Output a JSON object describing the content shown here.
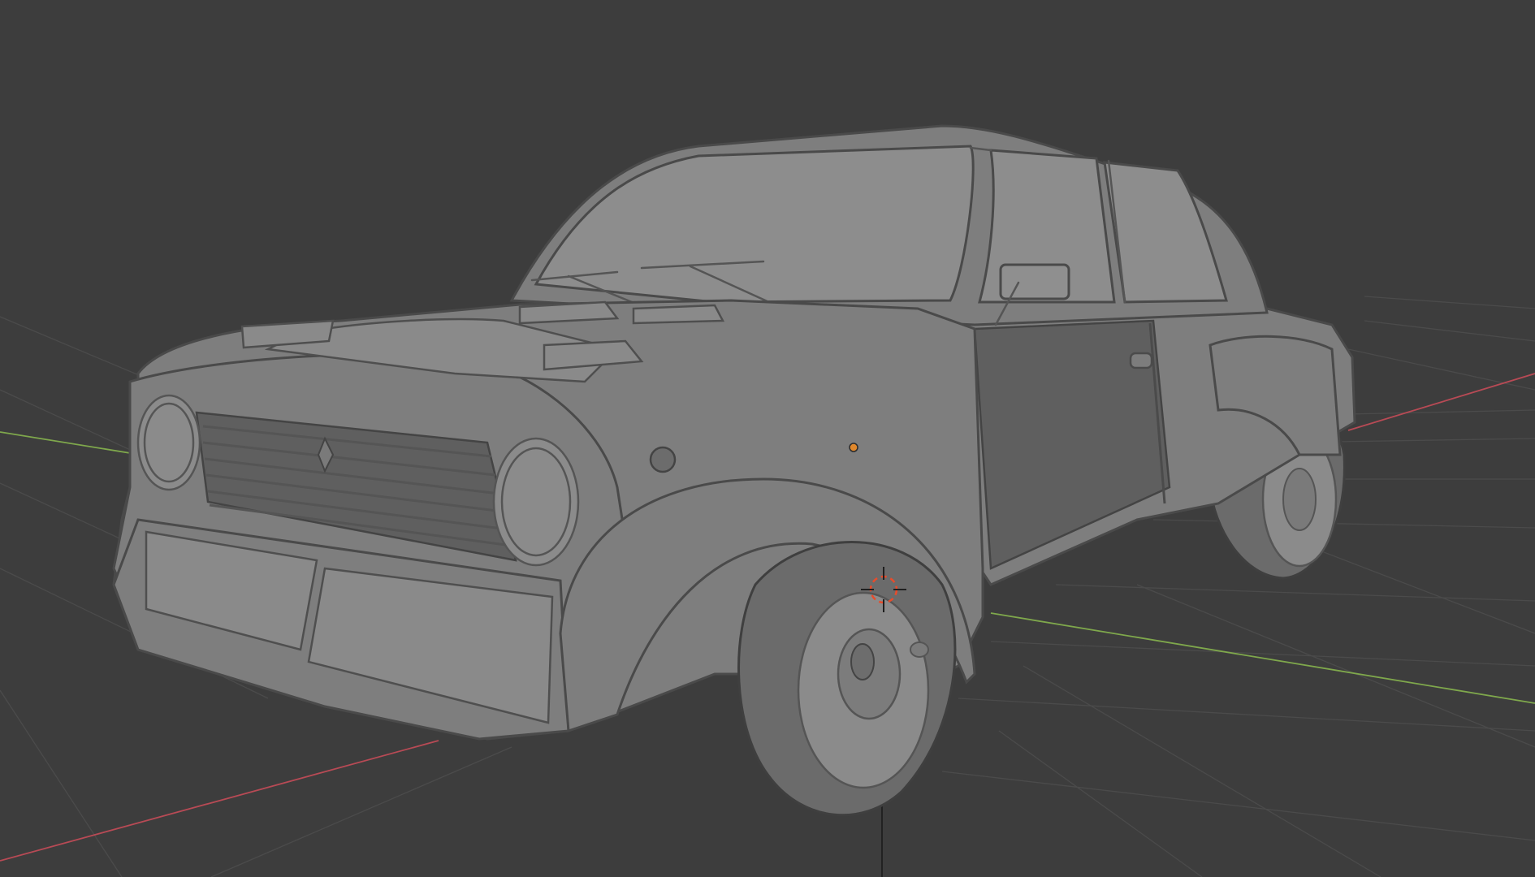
{
  "viewport": {
    "background": "#3d3d3d",
    "grid_color": "#4b4b4b",
    "axis_x_color": "#b84a55",
    "axis_y_color": "#7fa84c",
    "axis_z_color": "#1f1f1f",
    "wire_color": "#5a5a5a"
  },
  "scene": {
    "object": "car-wireframe-model",
    "icons": [
      "origin-point-icon",
      "3d-cursor-icon"
    ],
    "origin_color": "#e0882c",
    "cursor_color": "#e84c2b"
  }
}
